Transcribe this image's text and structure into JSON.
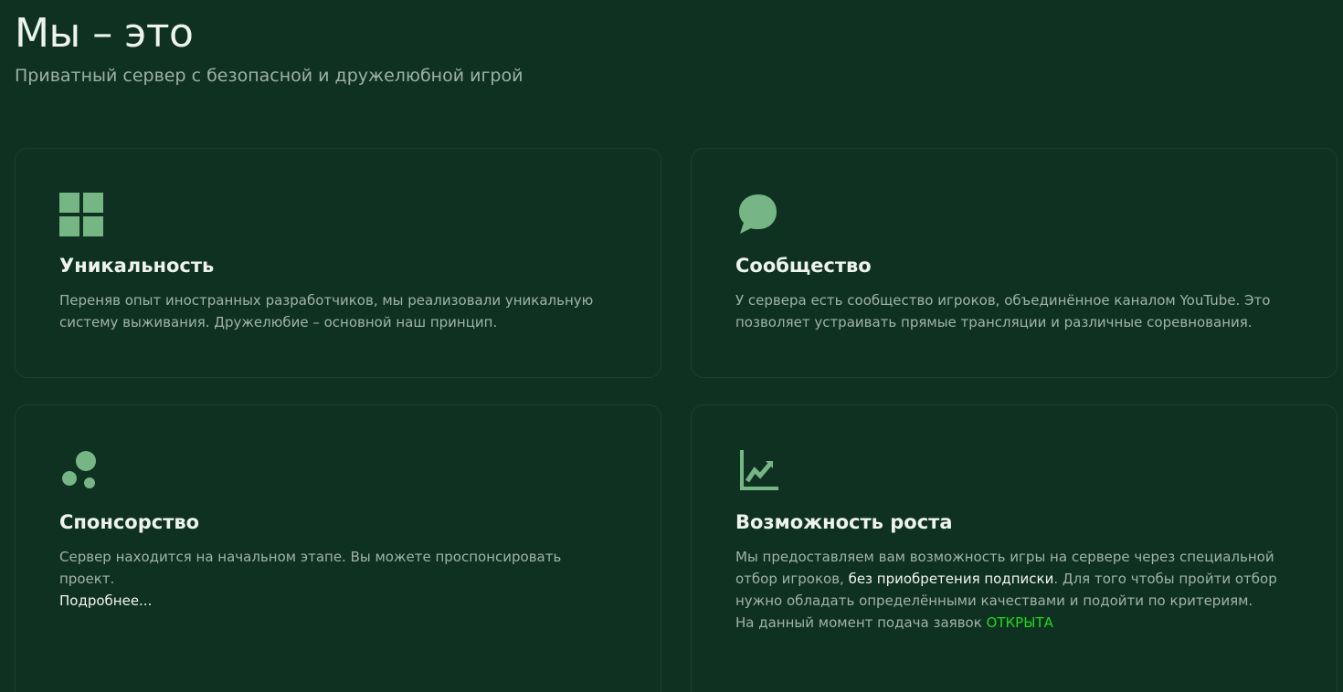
{
  "hero": {
    "title": "Мы – это",
    "subtitle": "Приватный сервер с безопасной и дружелюбной игрой"
  },
  "colors": {
    "background": "#0f3121",
    "icon": "#76b685",
    "accent_status": "#21d621"
  },
  "cards": [
    {
      "icon": "grid-icon",
      "title": "Уникальность",
      "text": "Переняв опыт иностранных разработчиков, мы реализовали уникальную систему выживания. Дружелюбие – основной наш принцип."
    },
    {
      "icon": "chat-bubble-icon",
      "title": "Сообщество",
      "text": "У сервера есть сообщество игроков, объединённое каналом YouTube. Это позволяет устраивать прямые трансляции и различные соревнования."
    },
    {
      "icon": "bubbles-icon",
      "title": "Спонсорство",
      "text": "Сервер находится на начальном этапе. Вы можете проспонсировать проект.",
      "link": "Подробнее..."
    },
    {
      "icon": "growth-chart-icon",
      "title": "Возможность роста",
      "text_before": "Мы предоставляем вам возможность игры на сервере через специальной отбор игроков, ",
      "text_highlight": "без приобретения подписки",
      "text_after": ". Для того чтобы пройти отбор нужно обладать определёнными качествами и подойти по критериям.",
      "status_prefix": "На данный момент подача заявок ",
      "status_value": "ОТКРЫТА"
    }
  ]
}
